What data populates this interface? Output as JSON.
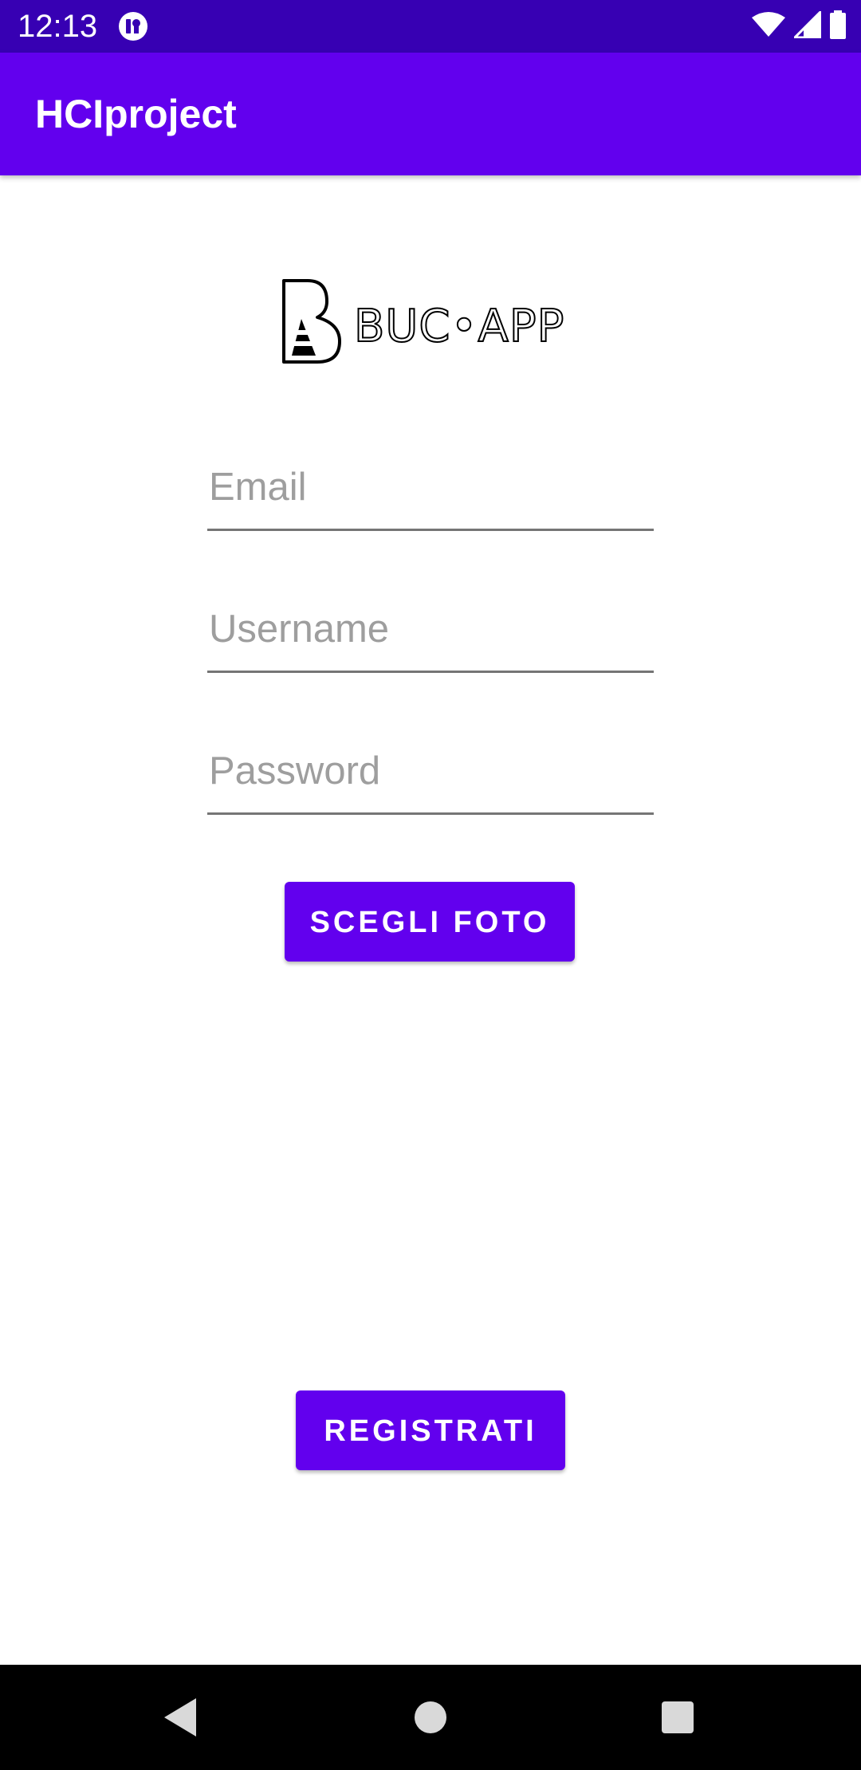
{
  "status_bar": {
    "time": "12:13",
    "icons": [
      "app-notification-icon",
      "wifi-icon",
      "cell-signal-icon",
      "battery-icon"
    ]
  },
  "app_bar": {
    "title": "HCIproject",
    "color": "#6200ee"
  },
  "logo": {
    "text": "BUC•APP",
    "icon": "traffic-cone-logo-icon"
  },
  "form": {
    "email": {
      "placeholder": "Email",
      "value": ""
    },
    "username": {
      "placeholder": "Username",
      "value": ""
    },
    "password": {
      "placeholder": "Password",
      "value": ""
    }
  },
  "buttons": {
    "choose_photo": "SCEGLI FOTO",
    "register": "REGISTRATI"
  },
  "nav_bar": {
    "icons": [
      "back-icon",
      "home-icon",
      "recents-icon"
    ]
  },
  "colors": {
    "status_bar": "#3700b3",
    "primary": "#6200ee",
    "nav_bar": "#000000"
  }
}
